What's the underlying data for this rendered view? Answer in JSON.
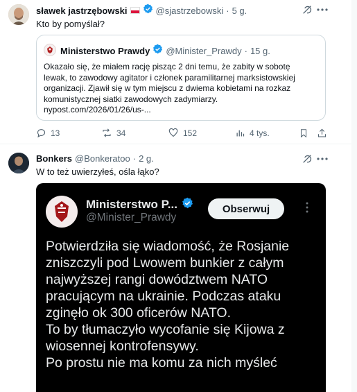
{
  "colors": {
    "accent_blue": "#1d9bf0",
    "muted_text": "#536471",
    "verified_gold": "#e2b719",
    "dark_card_bg": "#000000"
  },
  "tweet1": {
    "author_name": "sławek jastrzębowski",
    "author_handle": "@sjastrzebowski",
    "separator": "·",
    "time": "5 g.",
    "text": "Kto by pomyślał?",
    "quote": {
      "author_name": "Ministerstwo Prawdy",
      "author_handle": "@Minister_Prawdy",
      "separator": "·",
      "time": "15 g.",
      "text_lines": [
        "Okazało się, że miałem rację pisząc 2 dni temu, że zabity w sobotę",
        "lewak, to zawodowy agitator i członek paramilitarnej marksistowskiej",
        "organizacji. Zjawił się w tym miejscu z dwiema kobietami na rozkaz",
        "komunistycznej siatki zawodowych zadymiarzy.",
        "nypost.com/2026/01/26/us-..."
      ]
    },
    "actions": {
      "replies": "13",
      "reposts": "34",
      "likes": "152",
      "views": "4 tys."
    }
  },
  "tweet2": {
    "author_name": "Bonkers",
    "author_handle": "@Bonkeratoo",
    "separator": "·",
    "time": "2 g.",
    "text": "W to też uwierzyłeś, ośla łąko?",
    "embedded": {
      "author_name": "Ministerstwo P...",
      "author_handle": "@Minister_Prawdy",
      "follow_label": "Obserwuj",
      "lines": [
        "Potwierdziła się wiadomość, że Rosjanie",
        "zniszczyli pod Lwowem bunkier z całym",
        "najwyższej rangi dowództwem NATO",
        "pracującym na ukrainie. Podczas ataku",
        "zginęło ok 300 oficerów NATO.",
        "To by tłumaczyło wycofanie się Kijowa z",
        "wiosennej kontrofensywy.",
        "Po prostu nie ma komu za nich myśleć"
      ]
    }
  }
}
